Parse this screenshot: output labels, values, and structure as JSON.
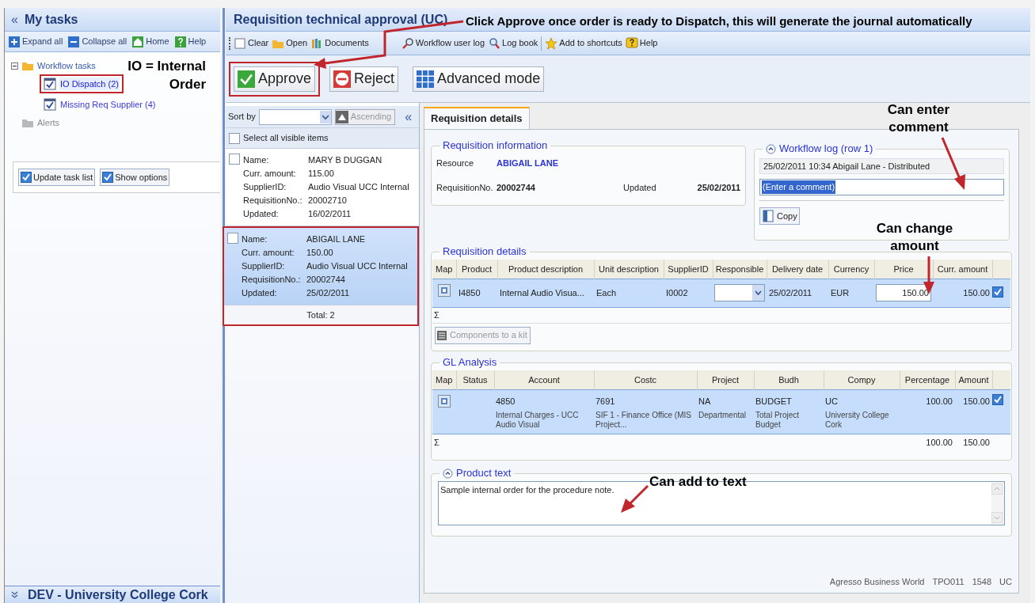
{
  "left_panel": {
    "title": "My tasks",
    "collapse": "«",
    "toolbar": [
      "Expand all",
      "Collapse all",
      "Home",
      "Help"
    ],
    "tree": [
      {
        "label": "Workflow tasks",
        "expanded": true,
        "children": [
          {
            "label": "IO Dispatch (2)",
            "selected": true
          },
          {
            "label": "Missing Req Supplier (4)",
            "selected": false
          }
        ]
      },
      {
        "label": "Alerts"
      }
    ],
    "options": [
      {
        "label": "Update task list",
        "checked": true
      },
      {
        "label": "Show options",
        "checked": true
      }
    ],
    "footer": "DEV - University College Cork"
  },
  "main": {
    "title": "Requisition technical approval (UC)",
    "toolbar": [
      "Clear",
      "Open",
      "Documents",
      "Workflow user log",
      "Log book",
      "Add to shortcuts",
      "Help"
    ],
    "actions": [
      "Approve",
      "Reject",
      "Advanced mode"
    ],
    "list": {
      "sort_label": "Sort by",
      "order_button": {
        "label": "Ascending",
        "disabled": true
      },
      "collapse": "«",
      "select_all": {
        "label": "Select all visible items",
        "checked": false
      },
      "items": [
        {
          "selected": false,
          "checked": false,
          "fields": [
            {
              "label": "Name:",
              "value": "MARY B DUGGAN"
            },
            {
              "label": "Curr. amount:",
              "value": "115.00"
            },
            {
              "label": "SupplierID:",
              "value": "Audio Visual UCC Internal"
            },
            {
              "label": "RequisitionNo.:",
              "value": "20002710"
            },
            {
              "label": "Updated:",
              "value": "16/02/2011"
            }
          ]
        },
        {
          "selected": true,
          "checked": false,
          "fields": [
            {
              "label": "Name:",
              "value": "ABIGAIL LANE"
            },
            {
              "label": "Curr. amount:",
              "value": "150.00"
            },
            {
              "label": "SupplierID:",
              "value": "Audio Visual UCC Internal"
            },
            {
              "label": "RequisitionNo.:",
              "value": "20002744"
            },
            {
              "label": "Updated:",
              "value": "25/02/2011"
            }
          ]
        }
      ],
      "total": "Total: 2"
    },
    "tabs": [
      {
        "label": "Requisition details",
        "selected": true
      }
    ],
    "requisition_info": {
      "title": "Requisition information",
      "resource_label": "Resource",
      "resource": "ABIGAIL LANE",
      "req_label": "RequisitionNo.",
      "req_no": "20002744",
      "updated_label": "Updated",
      "updated": "25/02/2011"
    },
    "workflow_log": {
      "title": "Workflow log (row 1)",
      "expanded": true,
      "entry": "25/02/2011 10:34 Abigail Lane - Distributed",
      "comment": "(Enter a comment)",
      "copy": "Copy"
    },
    "requisition_details": {
      "title": "Requisition details",
      "columns": [
        "Map",
        "Product",
        "Product description",
        "Unit description",
        "SupplierID",
        "Responsible",
        "Delivery date",
        "Currency",
        "Price",
        "Curr. amount"
      ],
      "rows": [
        {
          "checked": true,
          "cells": [
            {
              "kind": "map"
            },
            {
              "kind": "text",
              "value": "I4850"
            },
            {
              "kind": "text",
              "value": "Internal Audio Visua..."
            },
            {
              "kind": "text",
              "value": "Each"
            },
            {
              "kind": "text",
              "value": "I0002"
            },
            {
              "kind": "dropdown"
            },
            {
              "kind": "text",
              "value": "25/02/2011"
            },
            {
              "kind": "text",
              "value": "EUR"
            },
            {
              "kind": "input",
              "value": "150.00"
            },
            {
              "kind": "number",
              "value": "150.00"
            }
          ]
        }
      ],
      "sum": "Σ",
      "button": "Components to a kit"
    },
    "gl_analysis": {
      "title": "GL Analysis",
      "columns": [
        "Map",
        "Status",
        "Account",
        "Costc",
        "Project",
        "Budh",
        "Compy",
        "Percentage",
        "Amount"
      ],
      "rows": [
        {
          "checked": true,
          "cells": [
            {
              "kind": "map"
            },
            {
              "kind": "blank"
            },
            {
              "kind": "text",
              "value": "4850",
              "sub": "Internal Charges - UCC Audio Visual"
            },
            {
              "kind": "text",
              "value": "7691",
              "sub": "SIF 1 - Finance Office (MIS Project..."
            },
            {
              "kind": "text",
              "value": "NA",
              "sub": "Departmental"
            },
            {
              "kind": "text",
              "value": "BUDGET",
              "sub": "Total Project Budget"
            },
            {
              "kind": "text",
              "value": "UC",
              "sub": "University College Cork"
            },
            {
              "kind": "number",
              "value": "100.00"
            },
            {
              "kind": "number",
              "value": "150.00"
            }
          ]
        }
      ],
      "sum": "Σ",
      "sum_percentage": "100.00",
      "sum_amount": "150.00"
    },
    "product_text": {
      "title": "Product text",
      "expanded": true,
      "value": "Sample internal order for the procedure note."
    },
    "status": [
      "Agresso Business World",
      "TPO011",
      "1548",
      "UC"
    ]
  },
  "annotations": [
    "Click Approve once order is ready to Dispatch, this will generate the journal automatically",
    "IO  = Internal Order",
    "Can enter comment",
    "Can change amount",
    "Can add to text"
  ]
}
